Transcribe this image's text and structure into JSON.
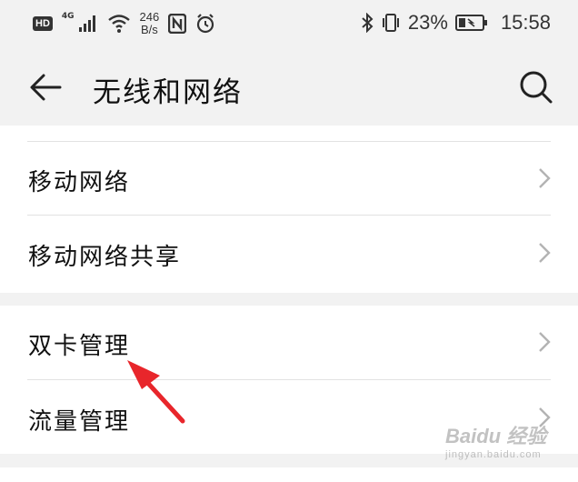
{
  "status_bar": {
    "hd_badge": "HD",
    "network_type": "4G",
    "speed_value": "246",
    "speed_unit": "B/s",
    "battery_percent": "23%",
    "time": "15:58",
    "icons": [
      "hd-icon",
      "signal-icon",
      "wifi-icon",
      "nfc-icon",
      "alarm-icon",
      "bluetooth-icon",
      "vibrate-icon",
      "battery-icon"
    ]
  },
  "toolbar": {
    "title": "无线和网络",
    "back_icon": "arrow-left-icon",
    "search_icon": "search-icon"
  },
  "list": {
    "items": [
      {
        "label": "移动网络",
        "icon": "chevron-right-icon"
      },
      {
        "label": "移动网络共享",
        "icon": "chevron-right-icon"
      },
      {
        "label": "双卡管理",
        "icon": "chevron-right-icon"
      },
      {
        "label": "流量管理",
        "icon": "chevron-right-icon"
      }
    ]
  },
  "annotation": {
    "arrow_color": "#e8262b"
  },
  "watermark": {
    "main": "Baidu 经验",
    "sub": "jingyan.baidu.com"
  },
  "colors": {
    "background": "#f2f2f2",
    "card": "#ffffff",
    "divider": "#e2e2e2",
    "chevron": "#b3b3b3"
  }
}
